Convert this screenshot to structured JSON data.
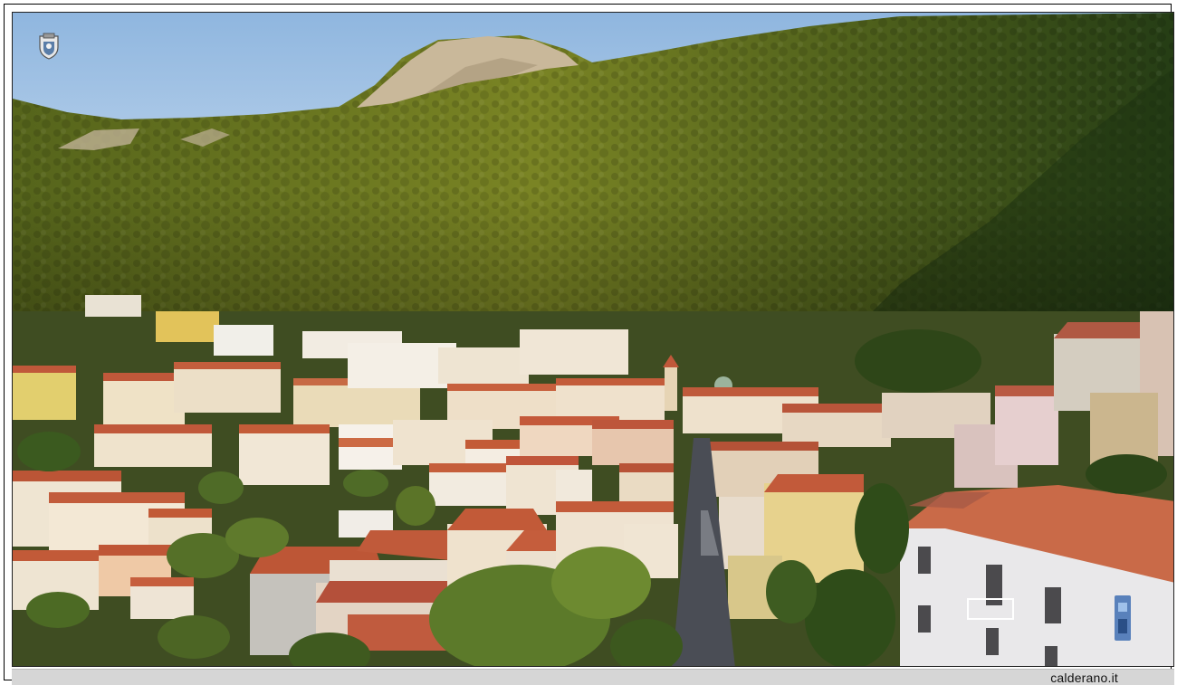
{
  "watermark": {
    "credit_text": "calderano.it",
    "emblem_icon": "town-crest-icon",
    "badge_icon": "blue-badge-icon"
  },
  "scene": {
    "subject": "hillside-town-at-sunset",
    "palette": {
      "sky": "#a9c8e6",
      "forest_lit": "#6f7a1e",
      "forest_shadow": "#2f4a17",
      "rock": "#c8b79a",
      "roof": "#c0583a",
      "wall_light": "#efe4d2",
      "street": "#4a4d55"
    }
  }
}
